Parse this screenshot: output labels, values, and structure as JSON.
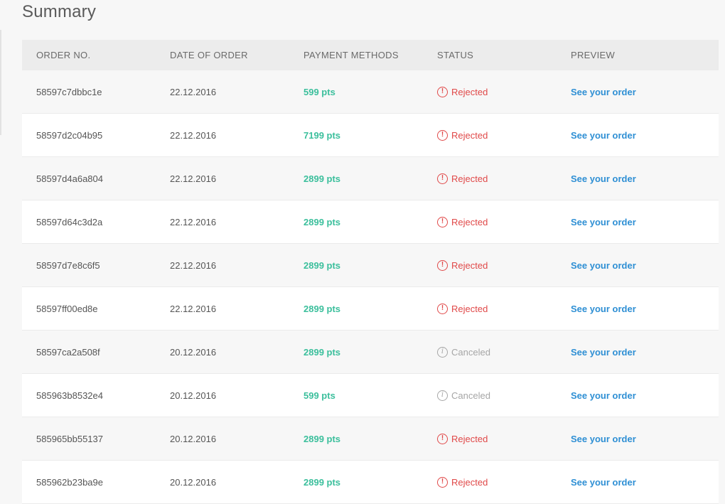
{
  "page": {
    "title": "Summary"
  },
  "table": {
    "headers": {
      "order_no": "ORDER NO.",
      "date": "DATE OF ORDER",
      "payment": "PAYMENT METHODS",
      "status": "STATUS",
      "preview": "PREVIEW"
    },
    "rows": [
      {
        "order_no": "58597c7dbbc1e",
        "date": "22.12.2016",
        "payment": "599 pts",
        "status": "Rejected",
        "status_icon": "alert-circle-icon",
        "preview": "See your order"
      },
      {
        "order_no": "58597d2c04b95",
        "date": "22.12.2016",
        "payment": "7199 pts",
        "status": "Rejected",
        "status_icon": "alert-circle-icon",
        "preview": "See your order"
      },
      {
        "order_no": "58597d4a6a804",
        "date": "22.12.2016",
        "payment": "2899 pts",
        "status": "Rejected",
        "status_icon": "alert-circle-icon",
        "preview": "See your order"
      },
      {
        "order_no": "58597d64c3d2a",
        "date": "22.12.2016",
        "payment": "2899 pts",
        "status": "Rejected",
        "status_icon": "alert-circle-icon",
        "preview": "See your order"
      },
      {
        "order_no": "58597d7e8c6f5",
        "date": "22.12.2016",
        "payment": "2899 pts",
        "status": "Rejected",
        "status_icon": "alert-circle-icon",
        "preview": "See your order"
      },
      {
        "order_no": "58597ff00ed8e",
        "date": "22.12.2016",
        "payment": "2899 pts",
        "status": "Rejected",
        "status_icon": "alert-circle-icon",
        "preview": "See your order"
      },
      {
        "order_no": "58597ca2a508f",
        "date": "20.12.2016",
        "payment": "2899 pts",
        "status": "Canceled",
        "status_icon": "info-circle-icon",
        "preview": "See your order"
      },
      {
        "order_no": "585963b8532e4",
        "date": "20.12.2016",
        "payment": "599 pts",
        "status": "Canceled",
        "status_icon": "info-circle-icon",
        "preview": "See your order"
      },
      {
        "order_no": "585965bb55137",
        "date": "20.12.2016",
        "payment": "2899 pts",
        "status": "Rejected",
        "status_icon": "alert-circle-icon",
        "preview": "See your order"
      },
      {
        "order_no": "585962b23ba9e",
        "date": "20.12.2016",
        "payment": "2899 pts",
        "status": "Rejected",
        "status_icon": "alert-circle-icon",
        "preview": "See your order"
      }
    ]
  },
  "colors": {
    "points": "#3bbf9c",
    "rejected": "#e04848",
    "canceled": "#a6a6a6",
    "link": "#2e8fd4"
  }
}
